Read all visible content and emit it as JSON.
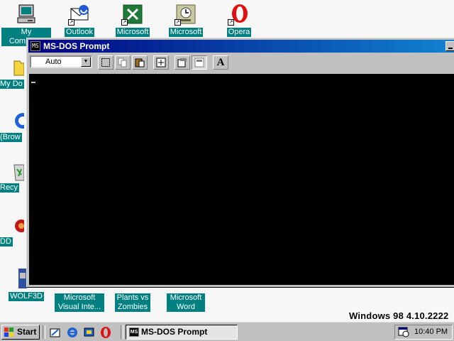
{
  "desktop": {
    "icons_top": [
      {
        "label": "My Computer"
      },
      {
        "label": "Outlook"
      },
      {
        "label": "Microsoft"
      },
      {
        "label": "Microsoft"
      },
      {
        "label": "Opera"
      }
    ],
    "icons_left": [
      {
        "label": "My Do"
      },
      {
        "label": "(Brow"
      },
      {
        "label": "Recy"
      },
      {
        "label": "DD"
      }
    ],
    "icons_bottom": [
      {
        "label": "WOLF3D"
      },
      {
        "label": "Microsoft Visual Inte..."
      },
      {
        "label": "Plants vs Zombies"
      },
      {
        "label": "Microsoft Word"
      }
    ],
    "background_color": "#f7f7f7",
    "label_bg_color": "#008080"
  },
  "window": {
    "title": "MS-DOS Prompt",
    "font_size_value": "Auto",
    "toolbar_icons": [
      "mark-icon",
      "copy-icon",
      "paste-icon",
      "fullscreen-icon",
      "properties-icon",
      "background-icon",
      "font-icon"
    ],
    "font_button_label": "A",
    "title_gradient": [
      "#000080",
      "#1084d0"
    ],
    "console_color": "#000000"
  },
  "watermark": {
    "text": "Windows 98 4.10.2222"
  },
  "taskbar": {
    "start_label": "Start",
    "task_label": "MS-DOS Prompt",
    "clock": "10:40 PM",
    "quicklaunch": [
      "show-desktop-icon",
      "internet-explorer-icon",
      "channels-icon",
      "opera-icon"
    ]
  }
}
